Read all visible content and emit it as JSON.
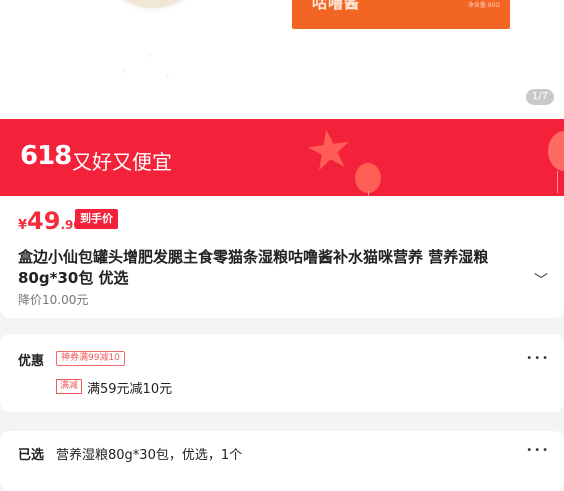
{
  "hero": {
    "package_title": "咕噜酱",
    "package_net": "净含量:80G",
    "image_counter": "1/7"
  },
  "banner": {
    "code": "618",
    "slogan": "又好又便宜"
  },
  "price": {
    "currency": "¥",
    "integer": "49",
    "decimal": ".90",
    "tag": "到手价"
  },
  "product": {
    "title": "盒边小仙包罐头增肥发腮主食零猫条湿粮咕噜酱补水猫咪营养 营养湿粮80g*30包 优选",
    "drop_note": "降价10.00元"
  },
  "offers": {
    "label": "优惠",
    "coupon": "神券满99减10",
    "reduce_tag": "满减",
    "reduce_text": "满59元减10元"
  },
  "selected": {
    "label": "已选",
    "value": "营养湿粮80g*30包，优选，1个"
  }
}
